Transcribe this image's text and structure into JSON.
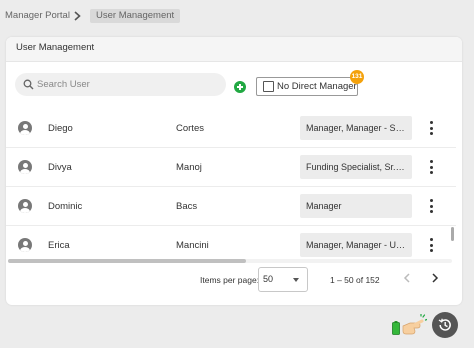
{
  "breadcrumb": {
    "portal": "Manager Portal",
    "current": "User Management"
  },
  "card": {
    "title": "User Management"
  },
  "search": {
    "placeholder": "Search User",
    "value": ""
  },
  "filter": {
    "label": "No Direct Manager",
    "badge": "131",
    "checked": false
  },
  "users": [
    {
      "first": "Diego",
      "last": "Cortes",
      "title": "Manager, Manager - Ser..."
    },
    {
      "first": "Divya",
      "last": "Manoj",
      "title": "Funding Specialist, Sr. U..."
    },
    {
      "first": "Dominic",
      "last": "Bacs",
      "title": "Manager"
    },
    {
      "first": "Erica",
      "last": "Mancini",
      "title": "Manager, Manager - Un..."
    }
  ],
  "pagination": {
    "items_label": "Items per page:",
    "page_size": "50",
    "range": "1 – 50 of 152"
  },
  "colors": {
    "accent_green": "#21a842",
    "badge_orange": "#f4a20c",
    "history_button": "#555555"
  },
  "icons": [
    "chevron-right-icon",
    "search-icon",
    "add-icon",
    "user-avatar-icon",
    "more-vert-icon",
    "chevron-left-icon",
    "history-icon",
    "battery-icon",
    "hand-pointer-icon"
  ]
}
